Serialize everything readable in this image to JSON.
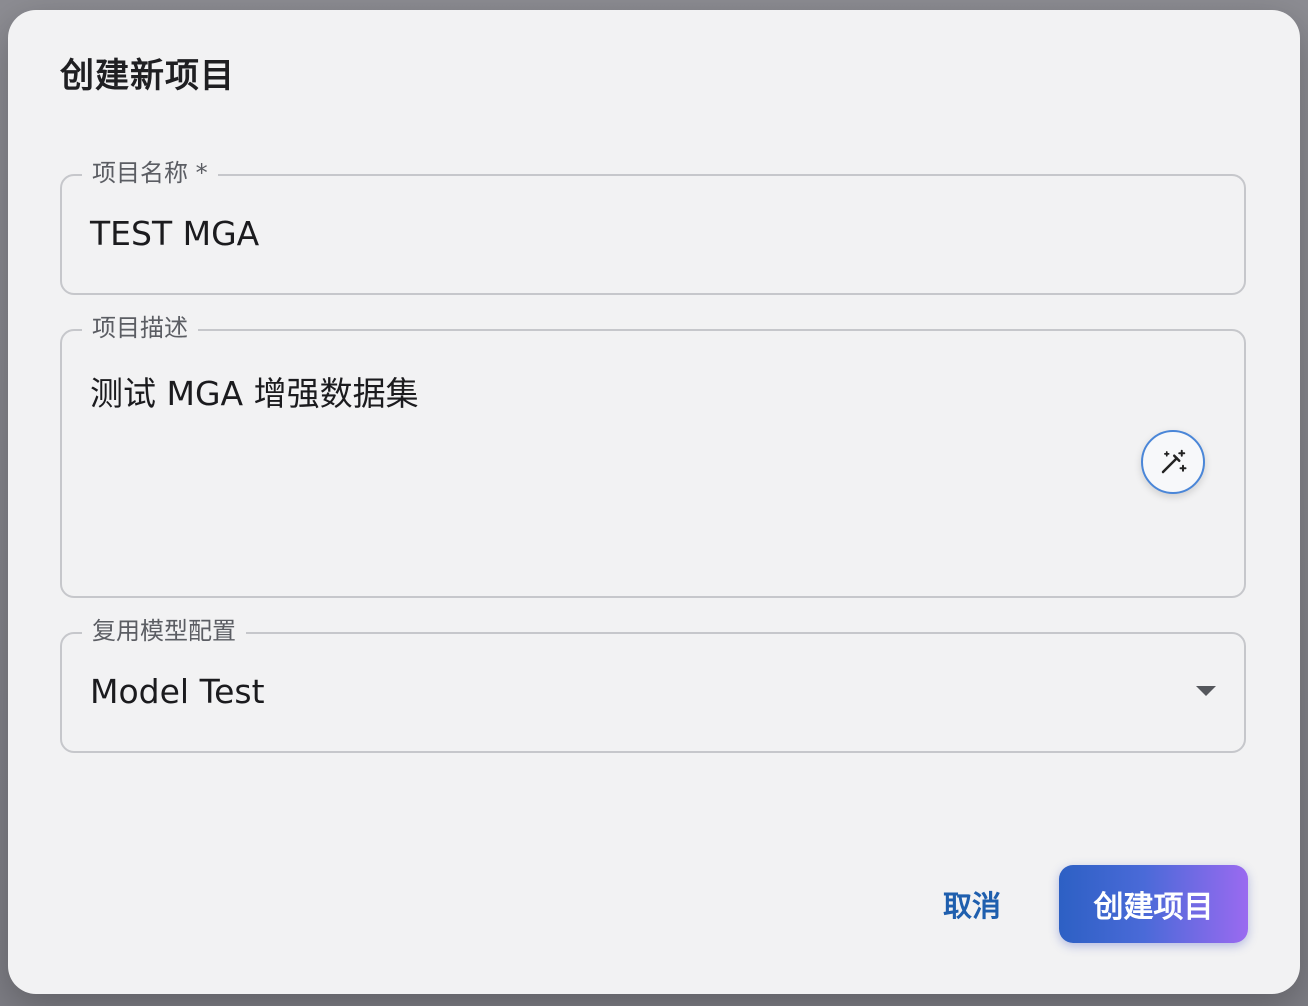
{
  "dialog": {
    "title": "创建新项目"
  },
  "fields": {
    "name": {
      "label": "项目名称 *",
      "value": "TEST MGA"
    },
    "description": {
      "label": "项目描述",
      "value": "测试 MGA 增强数据集",
      "magic_icon": "magic-wand-icon"
    },
    "model_config": {
      "label": "复用模型配置",
      "value": "Model Test",
      "dropdown_icon": "chevron-down-icon"
    }
  },
  "actions": {
    "cancel_label": "取消",
    "create_label": "创建项目"
  },
  "colors": {
    "accent": "#1f5fae",
    "button_gradient_start": "#2d60c4",
    "button_gradient_end": "#9a6af0",
    "dialog_bg": "#f2f2f3"
  }
}
